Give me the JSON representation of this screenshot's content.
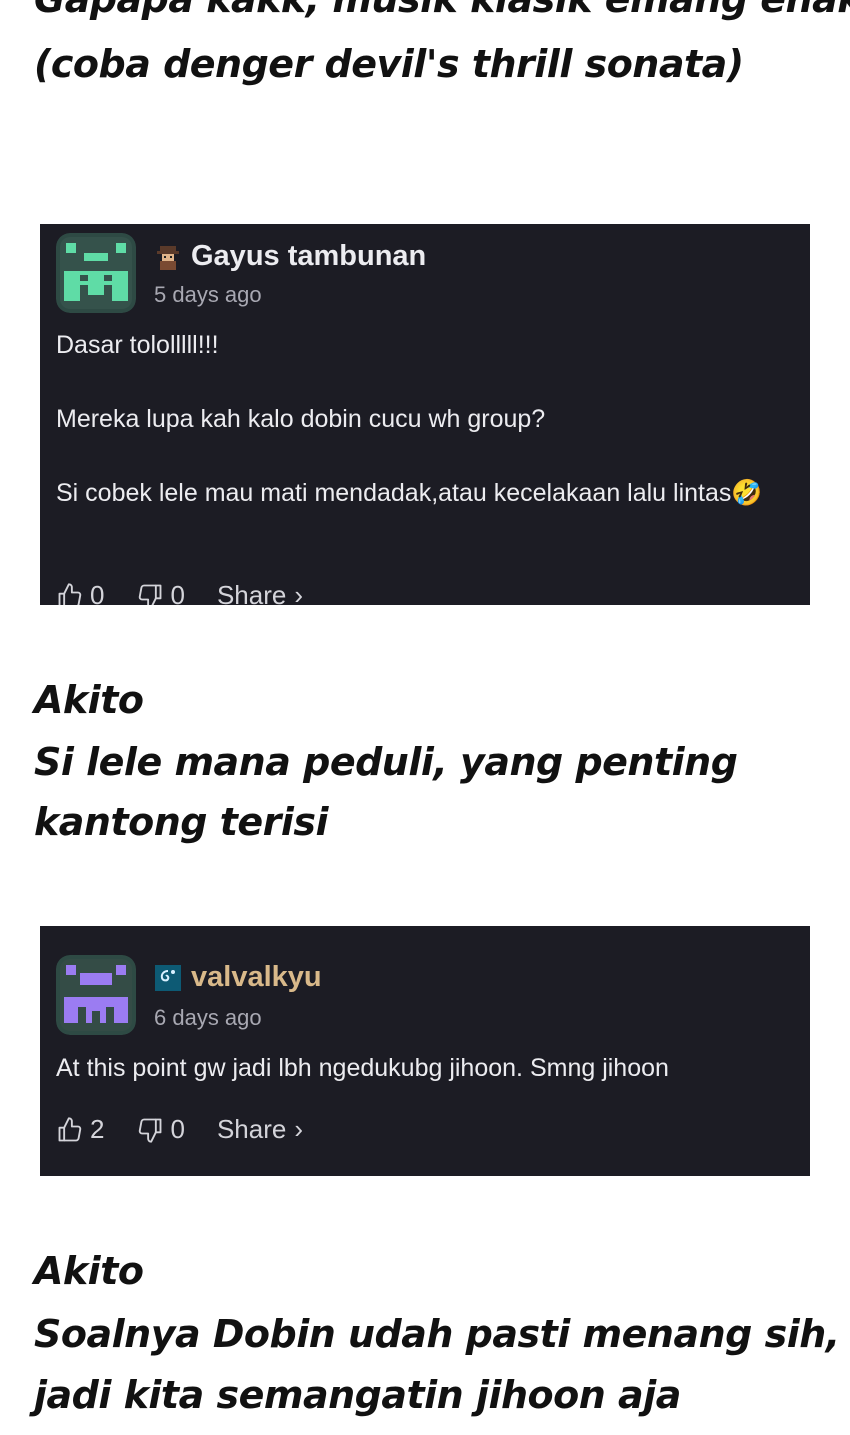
{
  "captions": [
    {
      "lines": [
        "Gapapa kakk, musik klasik emang enakk",
        "(coba denger devil's thrill sonata)"
      ]
    },
    {
      "lines": [
        "Akito",
        "Si lele mana peduli, yang penting",
        " kantong terisi"
      ]
    },
    {
      "lines": [
        "Akito",
        "Soalnya Dobin udah pasti menang sih,",
        " jadi kita semangatin jihoon aja"
      ]
    }
  ],
  "comments": [
    {
      "username": "Gayus tambunan",
      "badge_icon": "detective-icon",
      "username_color": "#ececf0",
      "avatar_color": "#5fdca6",
      "time": "5 days ago",
      "paragraphs": [
        "Dasar tololllll!!!",
        "Mereka lupa kah kalo dobin cucu wh group?",
        "Si cobek lele mau mati mendadak,atau kecelakaan lalu lintas🤣"
      ],
      "likes": "0",
      "dislikes": "0",
      "share_label": "Share"
    },
    {
      "username": "valvalkyu",
      "badge_icon": "swirl-icon",
      "username_color": "#d9b98a",
      "avatar_color": "#9b7cf2",
      "time": "6 days ago",
      "paragraphs": [
        "At this point gw jadi lbh ngedukubg jihoon. Smng jihoon"
      ],
      "likes": "2",
      "dislikes": "0",
      "share_label": "Share"
    }
  ]
}
